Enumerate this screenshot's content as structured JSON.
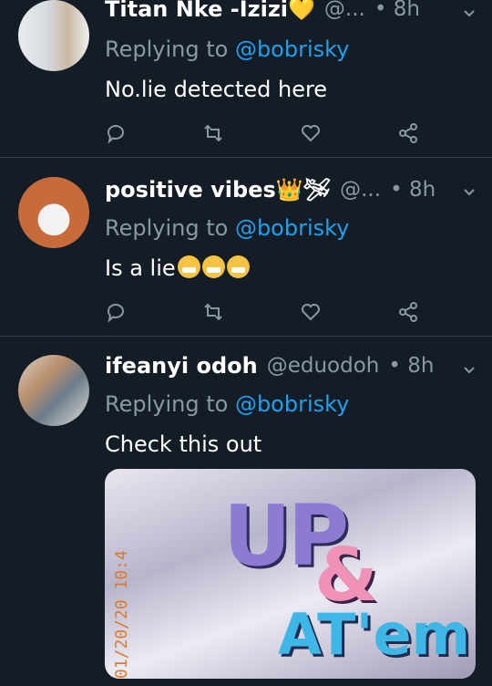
{
  "tweets": [
    {
      "name": "Titan Nke -Izizi💛",
      "handle": "@...",
      "time": "• 8h",
      "reply_prefix": "Replying to ",
      "reply_to": "@bobrisky",
      "text": "No.lie detected here"
    },
    {
      "name": "positive vibes👑🛩",
      "handle": "@...",
      "time": "• 8h",
      "reply_prefix": "Replying to ",
      "reply_to": "@bobrisky",
      "text": "Is a lie"
    },
    {
      "name": "ifeanyi odoh",
      "handle": "@eduodoh",
      "time": "• 8h",
      "reply_prefix": "Replying to ",
      "reply_to": "@bobrisky",
      "text": "Check this out",
      "media": {
        "title_main": "UP",
        "title_amp": "&",
        "title_sub": "AT'em",
        "date_stamp": "01/20/20 10:4"
      }
    }
  ],
  "icons": [
    "reply-icon",
    "retweet-icon",
    "like-icon",
    "share-icon",
    "chevron-down-icon"
  ],
  "colors": {
    "background": "#141d26",
    "muted": "#8899a6",
    "accent": "#1da1f2"
  }
}
